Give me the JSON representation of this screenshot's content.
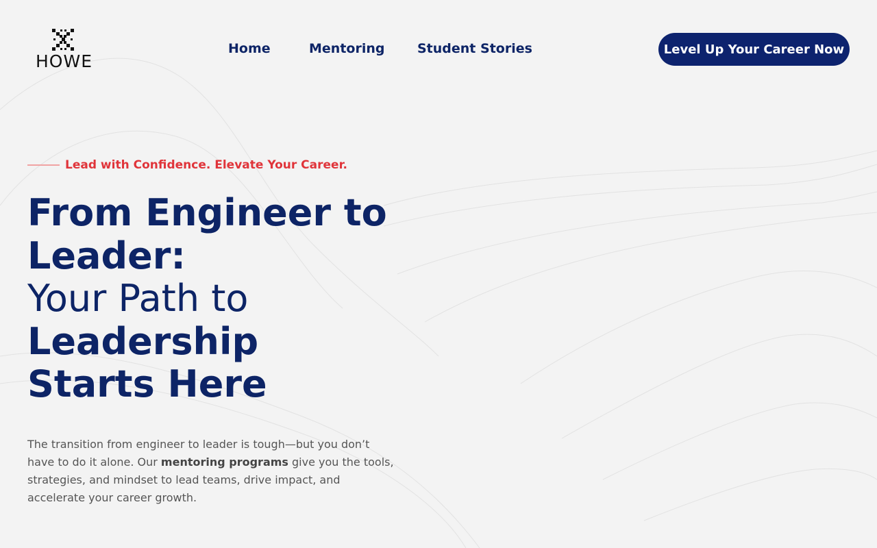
{
  "brand": {
    "name": "HOWE",
    "logo_icon": "dotted-x-logo-icon"
  },
  "nav": {
    "items": [
      {
        "label": "Home"
      },
      {
        "label": "Mentoring"
      },
      {
        "label": "Student Stories"
      }
    ],
    "cta_label": "Level Up Your Career Now"
  },
  "hero": {
    "tagline": "Lead with Confidence. Elevate Your Career.",
    "headline": {
      "line1": "From Engineer to",
      "line2": "Leader:",
      "line3": "Your Path to",
      "line4": "Leadership",
      "line5": "Starts Here"
    },
    "description": {
      "before": "The transition from engineer to leader is tough—but you don’t have to do it alone. Our ",
      "emphasis": "mentoring programs",
      "after": " give you the tools, strategies, and mindset to lead teams, drive impact, and accelerate your career growth."
    }
  },
  "colors": {
    "background": "#f3f3f3",
    "navy": "#0d2466",
    "accent_red": "#e0343a",
    "cta_bg": "#0d236e"
  }
}
